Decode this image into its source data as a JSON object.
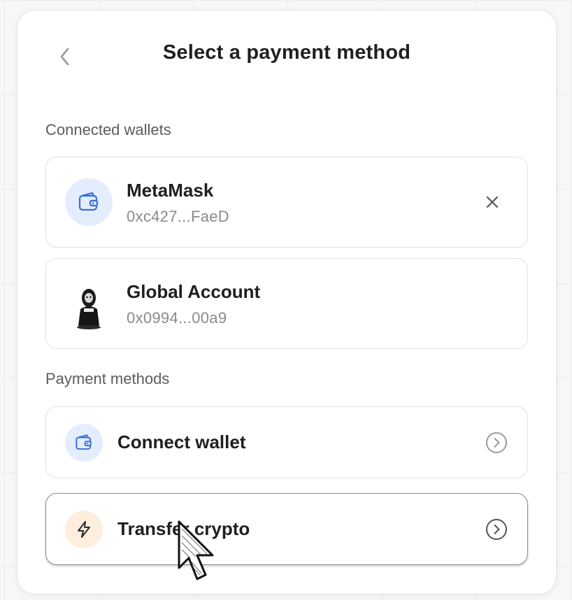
{
  "header": {
    "title": "Select a payment method",
    "back_icon": "chevron-left-icon"
  },
  "connected": {
    "label": "Connected wallets",
    "wallets": [
      {
        "name": "MetaMask",
        "address": "0xc427...FaeD",
        "icon": "wallet-icon",
        "removable": true
      },
      {
        "name": "Global Account",
        "address": "0x0994...00a9",
        "icon": "avatar"
      }
    ]
  },
  "methods": {
    "label": "Payment methods",
    "items": [
      {
        "label": "Connect wallet",
        "icon": "wallet-icon",
        "accent": "#e3edfd",
        "selected": false
      },
      {
        "label": "Transfer crypto",
        "icon": "lightning-icon",
        "accent": "#fdeedd",
        "selected": true
      }
    ]
  },
  "colors": {
    "wallet_icon_stroke": "#3b6fd4",
    "text_primary": "#1f1f1f",
    "text_secondary": "#8a8a8a"
  }
}
